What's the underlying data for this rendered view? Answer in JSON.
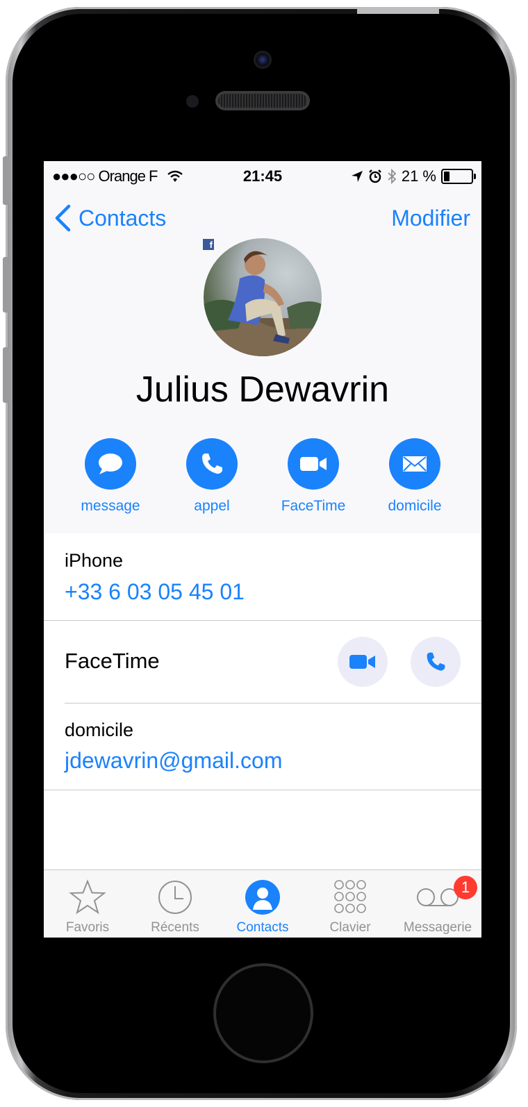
{
  "status_bar": {
    "carrier": "●●●○○ Orange F",
    "time": "21:45",
    "battery": "21 %"
  },
  "nav": {
    "back_label": "Contacts",
    "edit_label": "Modifier"
  },
  "contact": {
    "name": "Julius Dewavrin",
    "avatar_source_badge": "f"
  },
  "actions": [
    {
      "label": "message",
      "icon": "message-bubble-icon"
    },
    {
      "label": "appel",
      "icon": "phone-icon"
    },
    {
      "label": "FaceTime",
      "icon": "video-camera-icon"
    },
    {
      "label": "domicile",
      "icon": "envelope-icon"
    }
  ],
  "fields": {
    "phone": {
      "label": "iPhone",
      "value": "+33 6 03 05 45 01"
    },
    "facetime": {
      "label": "FaceTime"
    },
    "email": {
      "label": "domicile",
      "value": "jdewavrin@gmail.com"
    }
  },
  "tabs": [
    {
      "label": "Favoris",
      "icon": "star-icon",
      "active": false
    },
    {
      "label": "Récents",
      "icon": "clock-icon",
      "active": false
    },
    {
      "label": "Contacts",
      "icon": "person-icon",
      "active": true
    },
    {
      "label": "Clavier",
      "icon": "keypad-icon",
      "active": false
    },
    {
      "label": "Messagerie",
      "icon": "voicemail-icon",
      "active": false,
      "badge": "1"
    }
  ],
  "colors": {
    "accent": "#1a82fb",
    "badge": "#ff3b30",
    "header_bg": "#f8f8fb"
  }
}
